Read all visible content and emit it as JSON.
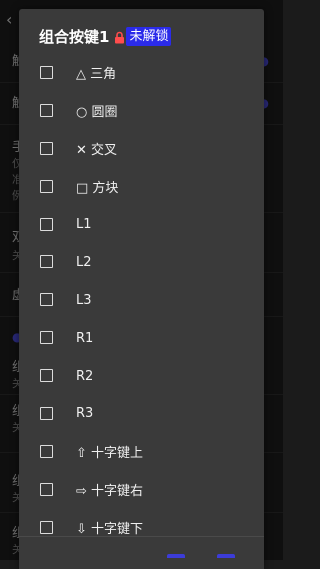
{
  "dialog": {
    "title": "组合按键1",
    "lock_icon": "lock-icon",
    "badge": "未解锁",
    "accent_color": "#2b2bea",
    "options": [
      {
        "label": "△ 三角",
        "checked": false
      },
      {
        "label": "○ 圆圈",
        "checked": false
      },
      {
        "label": "✕ 交叉",
        "checked": false
      },
      {
        "label": "□ 方块",
        "checked": false
      },
      {
        "label": "L1",
        "checked": false
      },
      {
        "label": "L2",
        "checked": false
      },
      {
        "label": "L3",
        "checked": false
      },
      {
        "label": "R1",
        "checked": false
      },
      {
        "label": "R2",
        "checked": false
      },
      {
        "label": "R3",
        "checked": false
      },
      {
        "label": "⇧ 十字键上",
        "checked": false
      },
      {
        "label": "⇨ 十字键右",
        "checked": false
      },
      {
        "label": "⇩ 十字键下",
        "checked": false
      }
    ]
  },
  "background": {
    "fragments": [
      "触",
      "触",
      "手",
      "仅",
      "准",
      "例",
      "双",
      "关",
      "虚",
      "组",
      "关",
      "组",
      "关",
      "组",
      "关",
      "组",
      "关"
    ]
  }
}
